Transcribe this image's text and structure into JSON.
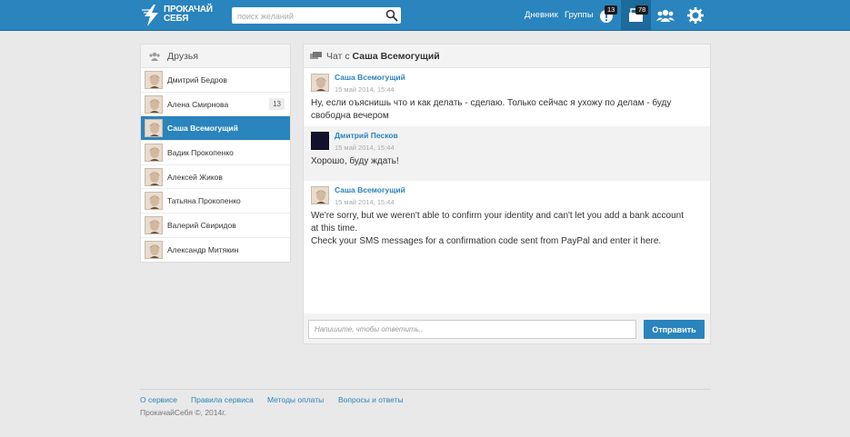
{
  "brand": {
    "line1": "ПРОКАЧАЙ",
    "line2": "СЕБЯ"
  },
  "search": {
    "placeholder": "поиск желаний"
  },
  "nav": {
    "diary": "Дневник",
    "groups": "Группы",
    "notifications_count": "13",
    "messages_count": "78"
  },
  "sidebar": {
    "title": "Друзья",
    "friends": [
      {
        "name": "Дмитрий Бедров",
        "count": ""
      },
      {
        "name": "Алена Смирнова",
        "count": "13"
      },
      {
        "name": "Саша Всемогущий",
        "count": ""
      },
      {
        "name": "Вадик Прокопенко",
        "count": ""
      },
      {
        "name": "Алексей Жиков",
        "count": ""
      },
      {
        "name": "Татьяна Прокопенко",
        "count": ""
      },
      {
        "name": "Валерий Свиридов",
        "count": ""
      },
      {
        "name": "Александр Митякин",
        "count": ""
      }
    ]
  },
  "chat": {
    "title_prefix": "Чат с",
    "title_name": "Саша Всемогущий",
    "messages": [
      {
        "author": "Саша Всемогущий",
        "time": "15 май 2014, 15:44",
        "text": "Ну, если оъяснишь что и как делать - сделаю. Только сейчас я ухожу по делам - буду свободна вечером"
      },
      {
        "author": "Дмитрий Песков",
        "time": "15 май 2014, 15:44",
        "text": "Хорошо, буду ждать!"
      },
      {
        "author": "Саша Всемогущий",
        "time": "15 май 2014, 15:44",
        "text": "We're sorry, but we weren't able to confirm your identity and can't let you add a bank account at this time.",
        "text2": "Check your SMS messages for a confirmation code sent from PayPal and enter it here."
      }
    ],
    "input_placeholder": "Напишите, чтобы ответить..",
    "send_label": "Отправить"
  },
  "footer": {
    "links": [
      "О сервисе",
      "Правила сервиса",
      "Методы оплаты",
      "Вопросы и ответы"
    ],
    "copyright": "ПрокачайСебя ©, 2014г."
  },
  "colors": {
    "accent": "#2a84bd",
    "header": "#2a84bd",
    "background": "#e9e9e9"
  }
}
